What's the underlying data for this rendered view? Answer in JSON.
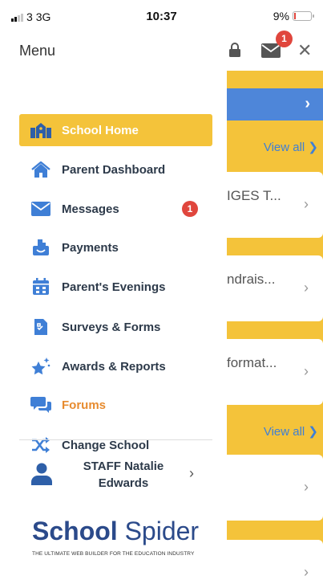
{
  "status_bar": {
    "carrier": "3",
    "network": "3G",
    "time": "10:37",
    "battery_percent": "9%",
    "battery_level": 0.09
  },
  "header": {
    "title": "Menu",
    "mail_badge": "1",
    "lock_icon": "lock-icon",
    "mail_icon": "mail-icon",
    "close_icon": "close-icon",
    "close_glyph": "✕"
  },
  "menu": {
    "items": [
      {
        "label": "School Home",
        "icon": "school-icon",
        "active": true
      },
      {
        "label": "Parent Dashboard",
        "icon": "home-icon"
      },
      {
        "label": "Messages",
        "icon": "envelope-icon",
        "badge": "1"
      },
      {
        "label": "Payments",
        "icon": "payments-icon"
      },
      {
        "label": "Parent's Evenings",
        "icon": "calendar-icon"
      },
      {
        "label": "Surveys & Forms",
        "icon": "forms-icon"
      },
      {
        "label": "Awards & Reports",
        "icon": "sparkle-star-icon"
      },
      {
        "label": "Forums",
        "icon": "chat-bubbles-icon"
      },
      {
        "label": "Change School",
        "icon": "shuffle-icon"
      }
    ],
    "user": {
      "name_line1": "STAFF Natalie",
      "name_line2": "Edwards",
      "icon": "user-icon",
      "chevron": "›"
    }
  },
  "logo": {
    "word1": "School",
    "word2": "Spider",
    "tagline": "THE ULTIMATE WEB BUILDER FOR THE EDUCATION INDUSTRY"
  },
  "background": {
    "view_all_1": "View all ❯",
    "view_all_2": "View all ❯",
    "cards": [
      "IGES T...",
      "ndrais...",
      "format...",
      "",
      ""
    ],
    "chevron": "›"
  },
  "colors": {
    "accent_yellow": "#f4c33a",
    "accent_blue": "#4e86d9",
    "badge_red": "#e0463d",
    "text_dark": "#2d3a4a",
    "forum_orange": "#e78b2f",
    "logo_blue": "#2b4a8a"
  }
}
